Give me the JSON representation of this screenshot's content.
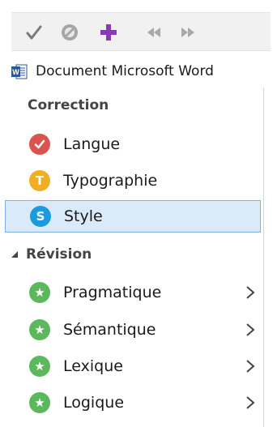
{
  "toolbar": {
    "buttons": [
      {
        "name": "accept",
        "icon": "check-icon",
        "color": "#7a7a7a"
      },
      {
        "name": "ignore",
        "icon": "block-icon",
        "color": "#9a9a9a"
      },
      {
        "name": "add",
        "icon": "plus-icon",
        "color": "#8a39b8"
      },
      {
        "name": "previous",
        "icon": "double-chevron-left-icon",
        "color": "#a0a0a0"
      },
      {
        "name": "next",
        "icon": "double-chevron-right-icon",
        "color": "#a0a0a0"
      }
    ]
  },
  "document": {
    "icon": "word-icon",
    "title": "Document Microsoft Word"
  },
  "sections": {
    "correction": {
      "title": "Correction",
      "items": [
        {
          "label": "Langue",
          "icon": "check-circle-icon",
          "color": "#d9534f",
          "glyph": "✓"
        },
        {
          "label": "Typographie",
          "icon": "t-circle-icon",
          "color": "#f0ad25",
          "glyph": "T"
        },
        {
          "label": "Style",
          "icon": "s-circle-icon",
          "color": "#1a9be0",
          "glyph": "S",
          "selected": true
        }
      ]
    },
    "revision": {
      "title": "Révision",
      "expander": "◢",
      "items": [
        {
          "label": "Pragmatique",
          "icon": "star-circle-icon",
          "color": "#5cb85c",
          "glyph": "★"
        },
        {
          "label": "Sémantique",
          "icon": "star-circle-icon",
          "color": "#5cb85c",
          "glyph": "★"
        },
        {
          "label": "Lexique",
          "icon": "star-circle-icon",
          "color": "#5cb85c",
          "glyph": "★"
        },
        {
          "label": "Logique",
          "icon": "star-circle-icon",
          "color": "#5cb85c",
          "glyph": "★"
        }
      ]
    }
  }
}
